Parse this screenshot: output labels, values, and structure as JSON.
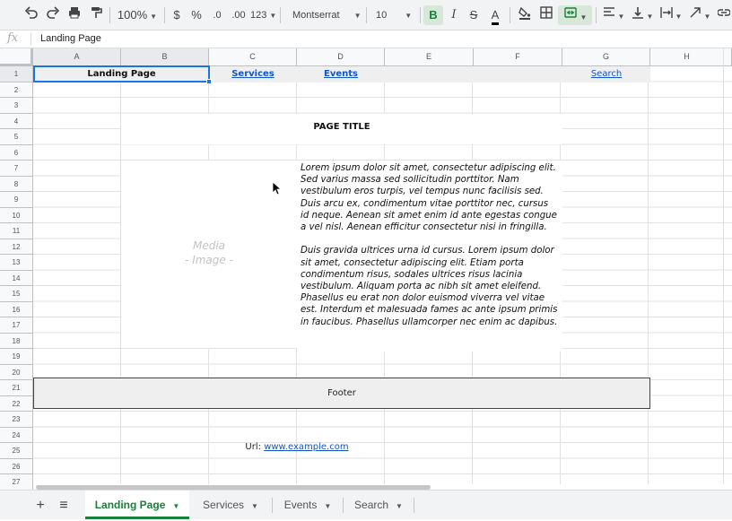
{
  "toolbar": {
    "zoom": "100%",
    "currency": "$",
    "percent": "%",
    "decrease_decimals": ".0",
    "increase_decimals": ".00",
    "more_formats": "123",
    "font": "Montserrat",
    "font_size": "10",
    "bold": "B",
    "italic": "I",
    "strike": "S",
    "text_color": "A",
    "accent_color": "#188038"
  },
  "formula_bar": {
    "fx": "fx",
    "value": "Landing Page"
  },
  "columns": [
    "A",
    "B",
    "C",
    "D",
    "E",
    "F",
    "G",
    "H"
  ],
  "rows": [
    "1",
    "2",
    "3",
    "4",
    "5",
    "6",
    "7",
    "8",
    "9",
    "10",
    "11",
    "12",
    "13",
    "14",
    "15",
    "16",
    "17",
    "18",
    "19",
    "20",
    "21",
    "22",
    "23",
    "24",
    "25",
    "26",
    "27"
  ],
  "sheet": {
    "nav": {
      "landing": "Landing Page",
      "services": "Services",
      "events": "Events",
      "search": "Search"
    },
    "page_title": "PAGE TITLE",
    "media_line1": "Media",
    "media_line2": "- Image -",
    "paragraph1": "Lorem ipsum dolor sit amet, consectetur adipiscing elit. Sed varius massa sed sollicitudin porttitor. Nam vestibulum eros turpis, vel tempus nunc facilisis sed. Duis arcu ex, condimentum vitae porttitor nec, cursus id neque. Aenean sit amet enim id ante egestas congue a vel nisl. Aenean efficitur consectetur nisi in fringilla.",
    "paragraph2": "Duis gravida ultrices urna id cursus. Lorem ipsum dolor sit amet, consectetur adipiscing elit. Etiam porta condimentum risus, sodales ultrices risus lacinia vestibulum. Aliquam porta ac nibh sit amet eleifend. Phasellus eu erat non dolor euismod viverra vel vitae est. Interdum et malesuada fames ac ante ipsum primis in faucibus. Phasellus ullamcorper nec enim ac dapibus.",
    "footer": "Footer",
    "url_label": "Url:",
    "url_link": "www.example.com"
  },
  "tabs": [
    {
      "label": "Landing Page",
      "active": true
    },
    {
      "label": "Services",
      "active": false
    },
    {
      "label": "Events",
      "active": false
    },
    {
      "label": "Search",
      "active": false
    }
  ],
  "tab_controls": {
    "add": "+",
    "list": "≡"
  }
}
